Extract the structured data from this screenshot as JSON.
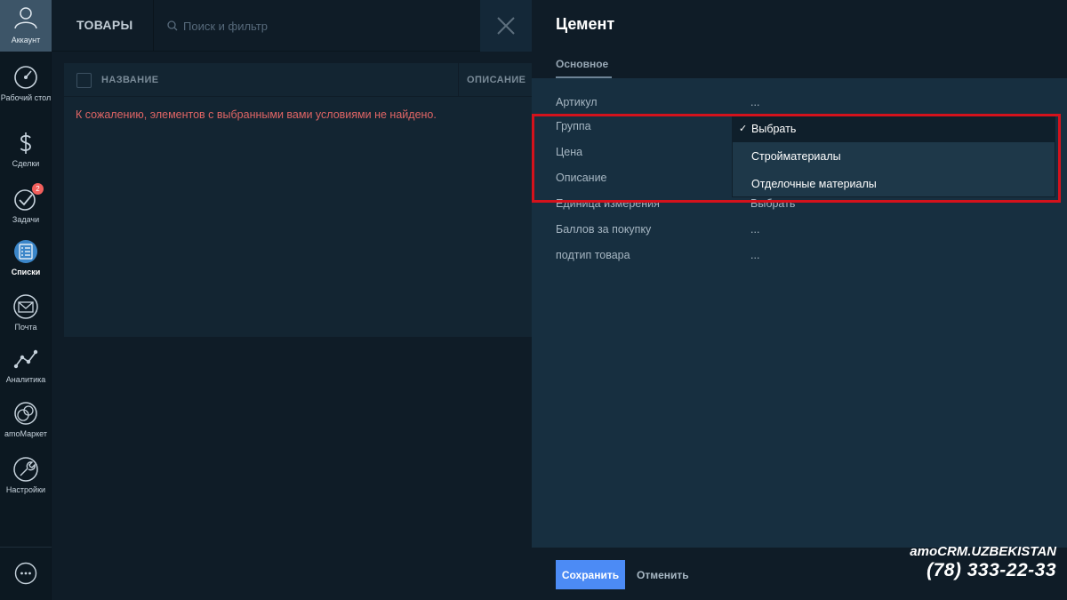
{
  "nav": {
    "account": "Аккаунт",
    "items": [
      {
        "label": "Рабочий стол",
        "icon": "dashboard-icon"
      },
      {
        "label": "Сделки",
        "icon": "dollar-icon"
      },
      {
        "label": "Задачи",
        "icon": "tasks-check-icon",
        "badge": "2"
      },
      {
        "label": "Списки",
        "icon": "lists-icon"
      },
      {
        "label": "Почта",
        "icon": "mail-icon"
      },
      {
        "label": "Аналитика",
        "icon": "analytics-icon"
      },
      {
        "label": "amoМаркет",
        "icon": "market-icon"
      },
      {
        "label": "Настройки",
        "icon": "wrench-icon"
      }
    ]
  },
  "list": {
    "title": "ТОВАРЫ",
    "search_placeholder": "Поиск и фильтр",
    "columns": [
      "НАЗВАНИЕ",
      "ОПИСАНИЕ"
    ],
    "empty_message": "К сожалению, элементов с выбранными вами условиями не найдено."
  },
  "panel": {
    "title": "Цемент",
    "tab": "Основное",
    "fields": [
      {
        "label": "Артикул",
        "value": "..."
      },
      {
        "label": "Группа",
        "value": ""
      },
      {
        "label": "Цена",
        "value": ""
      },
      {
        "label": "Описание",
        "value": ""
      },
      {
        "label": "Единица измерения",
        "value": "Выбрать"
      },
      {
        "label": "Баллов за покупку",
        "value": "..."
      },
      {
        "label": "подтип товара",
        "value": "..."
      }
    ],
    "dropdown": {
      "options": [
        "Выбрать",
        "Стройматериалы",
        "Отделочные материалы"
      ],
      "selected": "Выбрать",
      "check": "✓"
    },
    "save_label": "Сохранить",
    "cancel_label": "Отменить"
  },
  "watermark": {
    "brand": "amoCRM.UZBEKISTAN",
    "phone": "(78) 333-22-33"
  },
  "colors": {
    "accent": "#4c8bf5",
    "error_text": "#e06565",
    "highlight_frame": "#d4121c"
  }
}
